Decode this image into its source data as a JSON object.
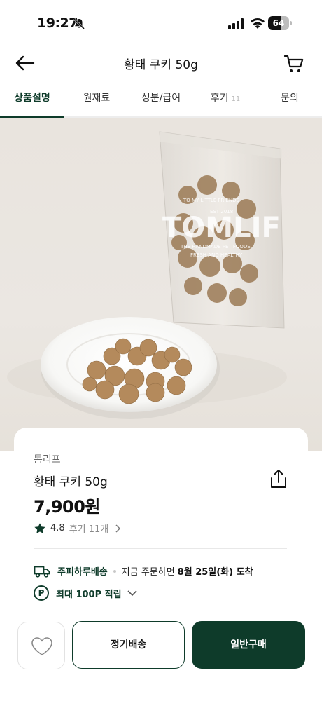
{
  "status_bar": {
    "time": "19:27",
    "battery_level": 64,
    "battery_text": "64"
  },
  "header": {
    "title": "황태 쿠키 50g",
    "back_icon": "arrow-left-icon",
    "cart_icon": "cart-icon"
  },
  "tabs": [
    {
      "label": "상품설명",
      "active": true
    },
    {
      "label": "원재료",
      "active": false
    },
    {
      "label": "성분/급여",
      "active": false
    },
    {
      "label": "후기",
      "count": "11",
      "active": false
    },
    {
      "label": "문의",
      "active": false
    }
  ],
  "hero": {
    "package_brand": "TOMLIF",
    "package_line1": "TO MY LITTLE FRIENDS",
    "package_line2": "EST 2018",
    "package_line3": "THE HANDMADE PET FOODS",
    "package_line4": "FRESH AND HEALTHY"
  },
  "product": {
    "brand": "톰리프",
    "name": "황태 쿠키 50g",
    "price": "7,900원",
    "rating": "4.8",
    "review_text": "후기 11개"
  },
  "delivery": {
    "name": "주피하루배송",
    "text": "지금 주문하면",
    "date": "8월 25일(화) 도착"
  },
  "points": {
    "icon_letter": "P",
    "text": "최대 100P 적립"
  },
  "actions": {
    "subscribe_label": "정기배송",
    "buy_label": "일반구매"
  },
  "colors": {
    "accent": "#0e3b2a",
    "background": "#ffffff"
  }
}
